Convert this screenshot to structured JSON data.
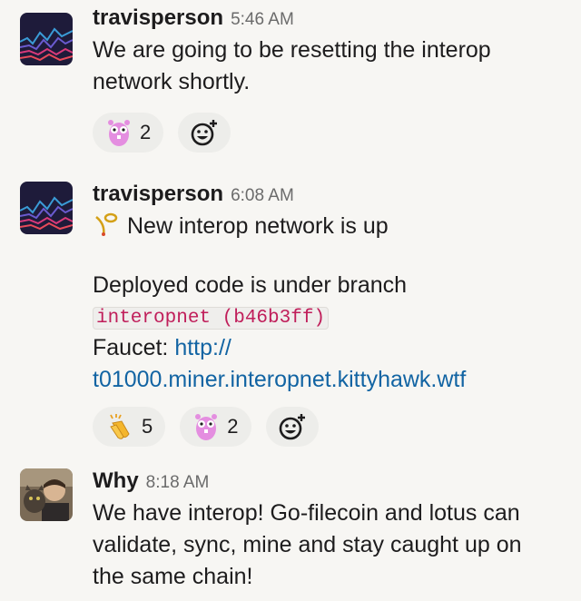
{
  "messages": [
    {
      "author": "travisperson",
      "time": "5:46 AM",
      "lines": [
        "We are going to be resetting the interop",
        "network shortly."
      ],
      "reactions": [
        {
          "emoji": "gopher-icon",
          "count": "2"
        }
      ]
    },
    {
      "author": "travisperson",
      "time": "6:08 AM",
      "line1": "New interop network is up",
      "line1_emoji": "postal-horn-icon",
      "line2": "Deployed code is under branch",
      "code": "interopnet (b46b3ff)",
      "faucet_label": "Faucet: ",
      "faucet_link_part1": "http://",
      "faucet_link_part2": "t01000.miner.interopnet.kittyhawk.wtf",
      "reactions": [
        {
          "emoji": "clapping-hands-icon",
          "count": "5"
        },
        {
          "emoji": "gopher-icon",
          "count": "2"
        }
      ]
    },
    {
      "author": "Why",
      "time": "8:18 AM",
      "lines": [
        "We have interop! Go-filecoin and lotus can",
        "validate, sync, mine and stay caught up on",
        "the same chain!"
      ]
    }
  ],
  "add_reaction_icon": "add-reaction-icon"
}
